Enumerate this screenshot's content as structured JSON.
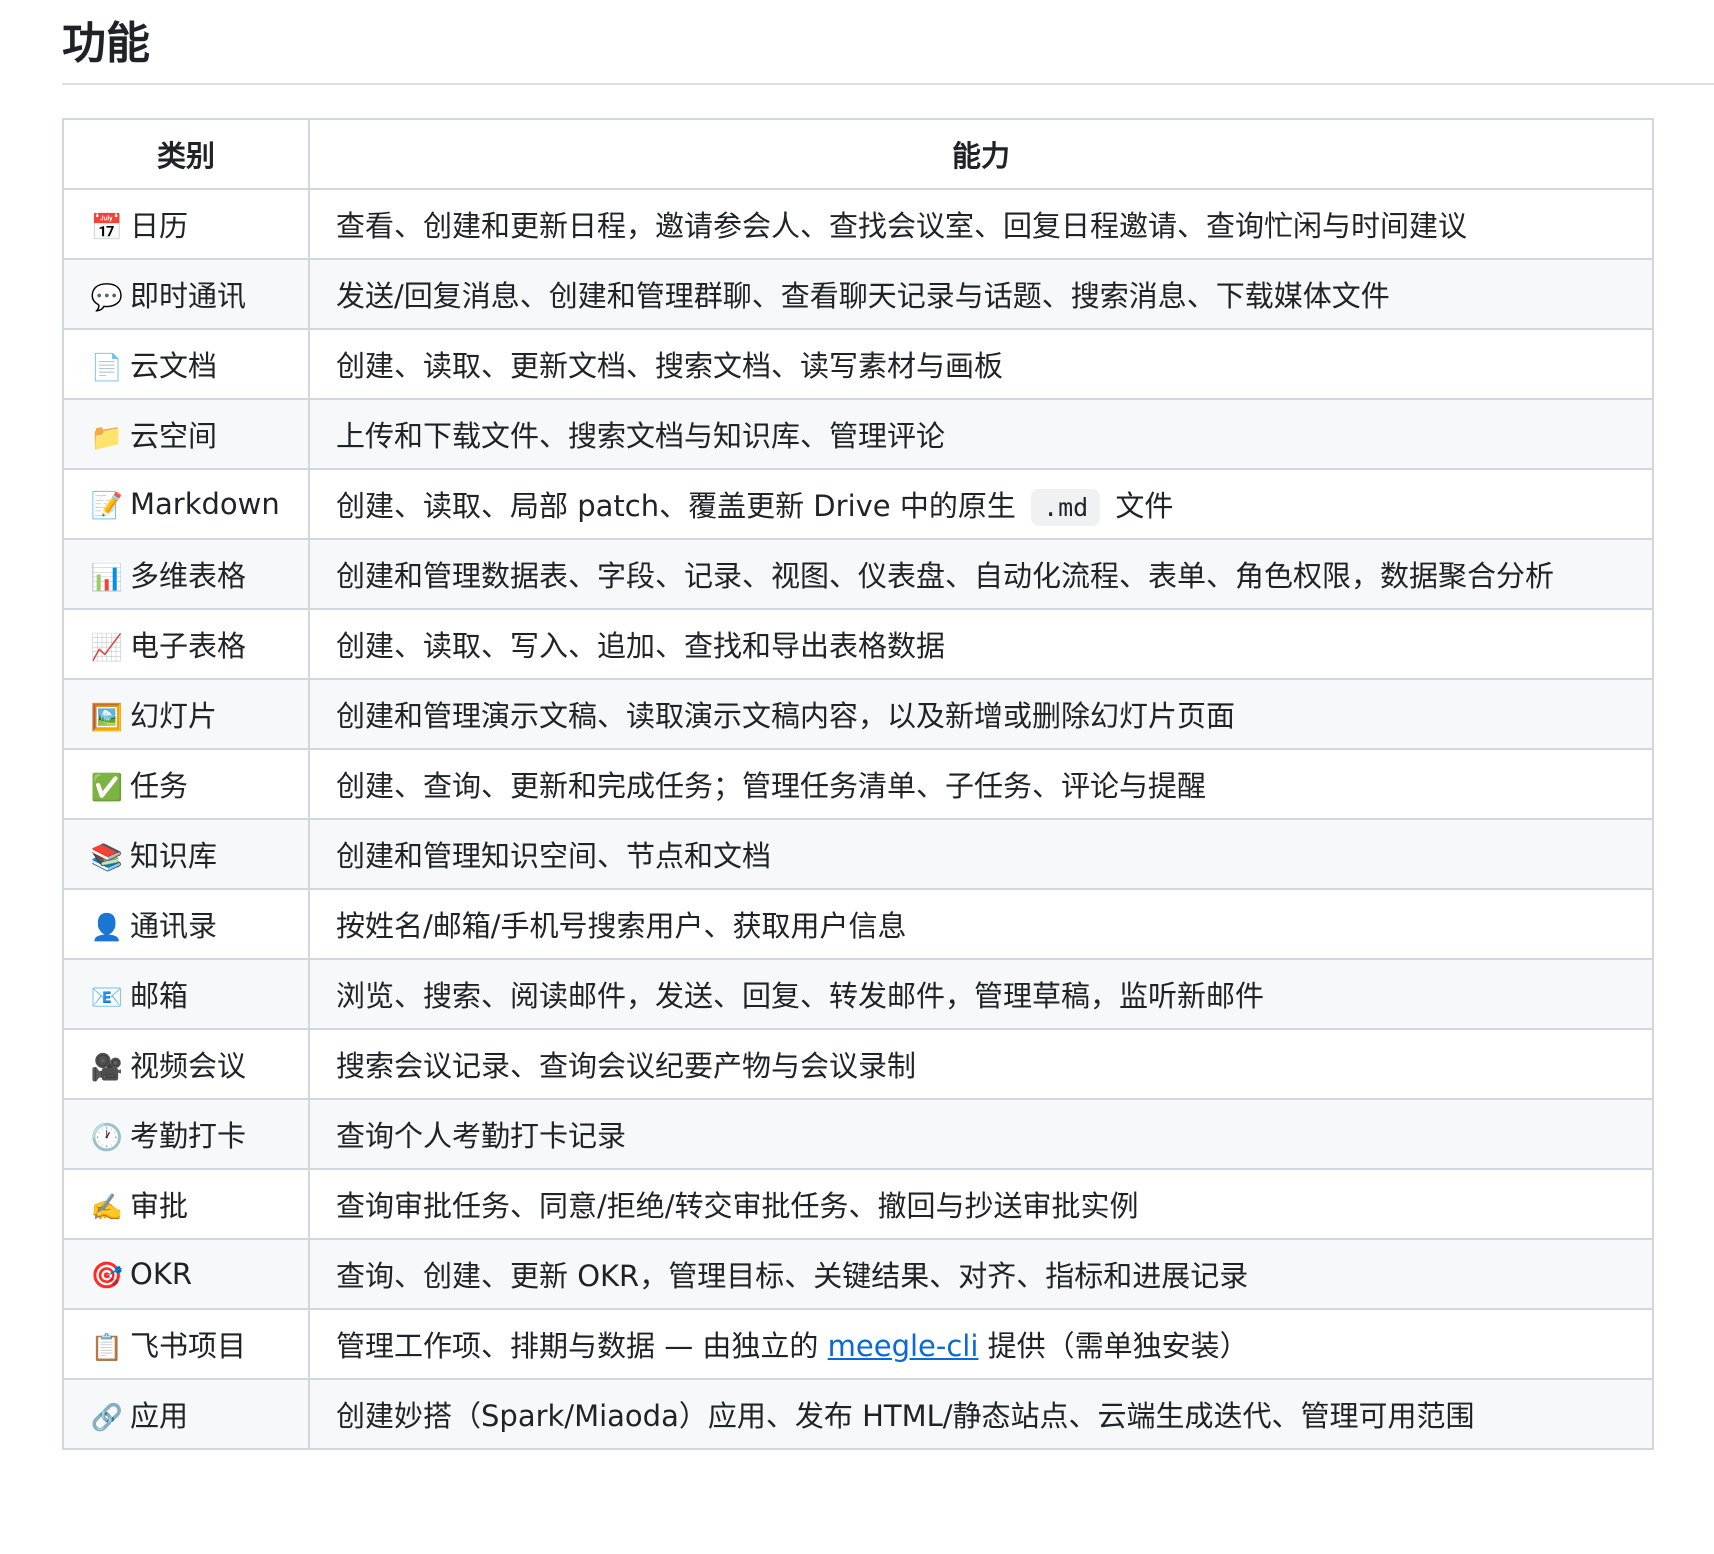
{
  "heading": "功能",
  "table": {
    "headers": [
      "类别",
      "能力"
    ],
    "rows": [
      {
        "icon": "📅",
        "icon_name": "calendar-icon",
        "category": "日历",
        "ability": "查看、创建和更新日程，邀请参会人、查找会议室、回复日程邀请、查询忙闲与时间建议"
      },
      {
        "icon": "💬",
        "icon_name": "speech-bubble-icon",
        "category": "即时通讯",
        "ability": "发送/回复消息、创建和管理群聊、查看聊天记录与话题、搜索消息、下载媒体文件"
      },
      {
        "icon": "📄",
        "icon_name": "page-icon",
        "category": "云文档",
        "ability": "创建、读取、更新文档、搜索文档、读写素材与画板"
      },
      {
        "icon": "📁",
        "icon_name": "folder-icon",
        "category": "云空间",
        "ability": "上传和下载文件、搜索文档与知识库、管理评论"
      },
      {
        "icon": "📝",
        "icon_name": "memo-icon",
        "category": "Markdown",
        "ability_before": "创建、读取、局部 patch、覆盖更新 Drive 中的原生 ",
        "ability_code": ".md",
        "ability_after": " 文件"
      },
      {
        "icon": "📊",
        "icon_name": "bar-chart-icon",
        "category": "多维表格",
        "ability": "创建和管理数据表、字段、记录、视图、仪表盘、自动化流程、表单、角色权限，数据聚合分析"
      },
      {
        "icon": "📈",
        "icon_name": "trend-chart-icon",
        "category": "电子表格",
        "ability": "创建、读取、写入、追加、查找和导出表格数据"
      },
      {
        "icon": "🖼️",
        "icon_name": "framed-picture-icon",
        "category": "幻灯片",
        "ability": "创建和管理演示文稿、读取演示文稿内容，以及新增或删除幻灯片页面"
      },
      {
        "icon": "✅",
        "icon_name": "check-mark-icon",
        "category": "任务",
        "ability": "创建、查询、更新和完成任务；管理任务清单、子任务、评论与提醒"
      },
      {
        "icon": "📚",
        "icon_name": "books-icon",
        "category": "知识库",
        "ability": "创建和管理知识空间、节点和文档"
      },
      {
        "icon": "👤",
        "icon_name": "person-icon",
        "category": "通讯录",
        "ability": "按姓名/邮箱/手机号搜索用户、获取用户信息"
      },
      {
        "icon": "📧",
        "icon_name": "email-icon",
        "category": "邮箱",
        "ability": "浏览、搜索、阅读邮件，发送、回复、转发邮件，管理草稿，监听新邮件"
      },
      {
        "icon": "🎥",
        "icon_name": "movie-camera-icon",
        "category": "视频会议",
        "ability": "搜索会议记录、查询会议纪要产物与会议录制"
      },
      {
        "icon": "🕐",
        "icon_name": "clock-icon",
        "category": "考勤打卡",
        "ability": "查询个人考勤打卡记录"
      },
      {
        "icon": "✍️",
        "icon_name": "writing-hand-icon",
        "category": "审批",
        "ability": "查询审批任务、同意/拒绝/转交审批任务、撤回与抄送审批实例"
      },
      {
        "icon": "🎯",
        "icon_name": "target-icon",
        "category": "OKR",
        "ability": "查询、创建、更新 OKR，管理目标、关键结果、对齐、指标和进展记录"
      },
      {
        "icon": "📋",
        "icon_name": "clipboard-icon",
        "category": "飞书项目",
        "ability_before": "管理工作项、排期与数据 — 由独立的 ",
        "ability_link": "meegle-cli",
        "ability_after": " 提供（需单独安装）"
      },
      {
        "icon": "🔗",
        "icon_name": "link-icon",
        "category": "应用",
        "ability": "创建妙搭（Spark/Miaoda）应用、发布 HTML/静态站点、云端生成迭代、管理可用范围"
      }
    ]
  }
}
